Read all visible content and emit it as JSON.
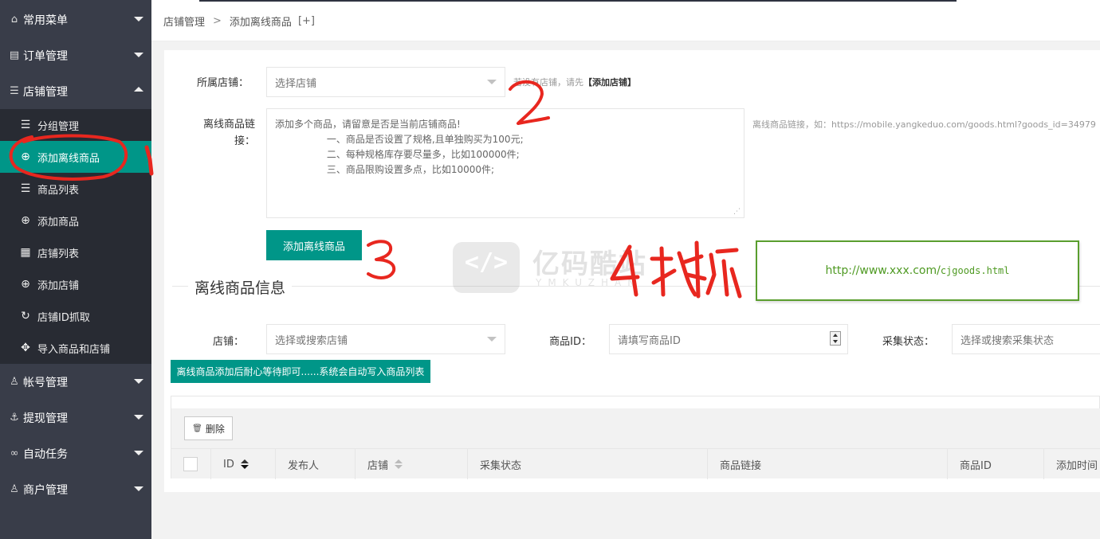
{
  "sidebar": {
    "groups": [
      {
        "label": "常用菜单",
        "icon": "home-icon"
      },
      {
        "label": "订单管理",
        "icon": "database-icon"
      },
      {
        "label": "店铺管理",
        "icon": "list-icon"
      },
      {
        "label": "帐号管理",
        "icon": "user-icon"
      },
      {
        "label": "提现管理",
        "icon": "anchor-icon"
      },
      {
        "label": "自动任务",
        "icon": "link-icon"
      },
      {
        "label": "商户管理",
        "icon": "user-icon"
      }
    ],
    "shop_items": [
      {
        "label": "分组管理",
        "icon": "list-icon"
      },
      {
        "label": "添加离线商品",
        "icon": "add-circle-icon"
      },
      {
        "label": "商品列表",
        "icon": "list-icon"
      },
      {
        "label": "添加商品",
        "icon": "add-circle-icon"
      },
      {
        "label": "店铺列表",
        "icon": "grid-icon"
      },
      {
        "label": "添加店铺",
        "icon": "add-circle-icon"
      },
      {
        "label": "店铺ID抓取",
        "icon": "refresh-icon"
      },
      {
        "label": "导入商品和店铺",
        "icon": "move-icon"
      }
    ]
  },
  "breadcrumb": {
    "parent": "店铺管理",
    "separator": ">",
    "current": "添加离线商品",
    "expand": "[+]"
  },
  "form": {
    "shop_label": "所属店铺：",
    "shop_placeholder": "选择店铺",
    "shop_hint": "若没有店铺，请先",
    "shop_hint_link": "【添加店铺】",
    "links_label_1": "离线商品链",
    "links_label_2": "接：",
    "links_value": "添加多个商品，请留意是否是当前店铺商品!\n                 一、商品是否设置了规格,且单独购买为100元;\n                 二、每种规格库存要尽量多，比如100000件;\n                 三、商品限购设置多点，比如10000件;",
    "links_hint": "离线商品链接，如：https://mobile.yangkeduo.com/goods.html?goods_id=34979",
    "submit_label": "添加离线商品"
  },
  "info": {
    "legend": "离线商品信息",
    "filter_shop_label": "店铺：",
    "filter_shop_placeholder": "选择或搜索店铺",
    "filter_id_label": "商品ID：",
    "filter_id_placeholder": "请填写商品ID",
    "filter_status_label": "采集状态：",
    "filter_status_placeholder": "选择或搜索采集状态",
    "notice": "离线商品添加后耐心等待即可......系统会自动写入商品列表",
    "delete_label": "删除",
    "columns": [
      "ID",
      "发布人",
      "店铺",
      "采集状态",
      "商品链接",
      "商品ID",
      "添加时间"
    ]
  },
  "overlay": {
    "url_prefix": "http://www.xxx.com/",
    "url_mono": "cjgoods.html",
    "watermark_cn": "亿码酷站",
    "watermark_en": "YMKUZHAN",
    "watermark_glyph": "</>"
  },
  "colors": {
    "accent": "#009688",
    "sidebar_bg": "#393d49",
    "submenu_bg": "#282b33",
    "annotation": "#e8271f",
    "url_green": "#4f9a23"
  }
}
